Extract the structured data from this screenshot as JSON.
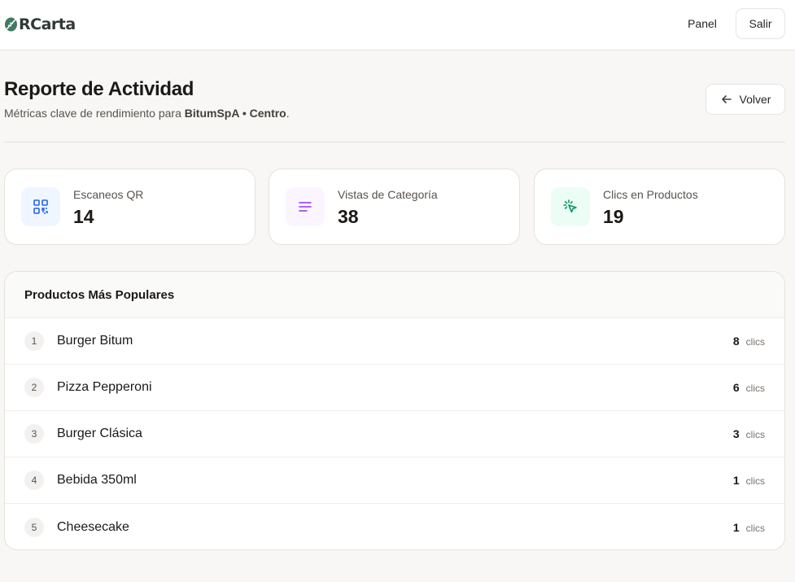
{
  "app": {
    "logo_text": "RCarta",
    "nav": {
      "panel_label": "Panel",
      "logout_label": "Salir"
    }
  },
  "header": {
    "title": "Reporte de Actividad",
    "subtitle_prefix": "Métricas clave de rendimiento para ",
    "business": "BitumSpA",
    "separator": " • ",
    "branch": "Centro",
    "subtitle_suffix": ".",
    "back_label": "Volver"
  },
  "stats": [
    {
      "label": "Escaneos QR",
      "value": "14",
      "icon": "qr-code-icon",
      "icon_color": "#2563eb",
      "icon_bg": "#eff6ff"
    },
    {
      "label": "Vistas de Categoría",
      "value": "38",
      "icon": "list-icon",
      "icon_color": "#9333ea",
      "icon_bg": "#faf5ff"
    },
    {
      "label": "Clics en Productos",
      "value": "19",
      "icon": "pointer-click-icon",
      "icon_color": "#059669",
      "icon_bg": "#ecfdf5"
    }
  ],
  "popular": {
    "title": "Productos Más Populares",
    "unit_label": "clics",
    "items": [
      {
        "rank": "1",
        "name": "Burger Bitum",
        "clicks": "8"
      },
      {
        "rank": "2",
        "name": "Pizza Pepperoni",
        "clicks": "6"
      },
      {
        "rank": "3",
        "name": "Burger Clásica",
        "clicks": "3"
      },
      {
        "rank": "4",
        "name": "Bebida 350ml",
        "clicks": "1"
      },
      {
        "rank": "5",
        "name": "Cheesecake",
        "clicks": "1"
      }
    ]
  }
}
